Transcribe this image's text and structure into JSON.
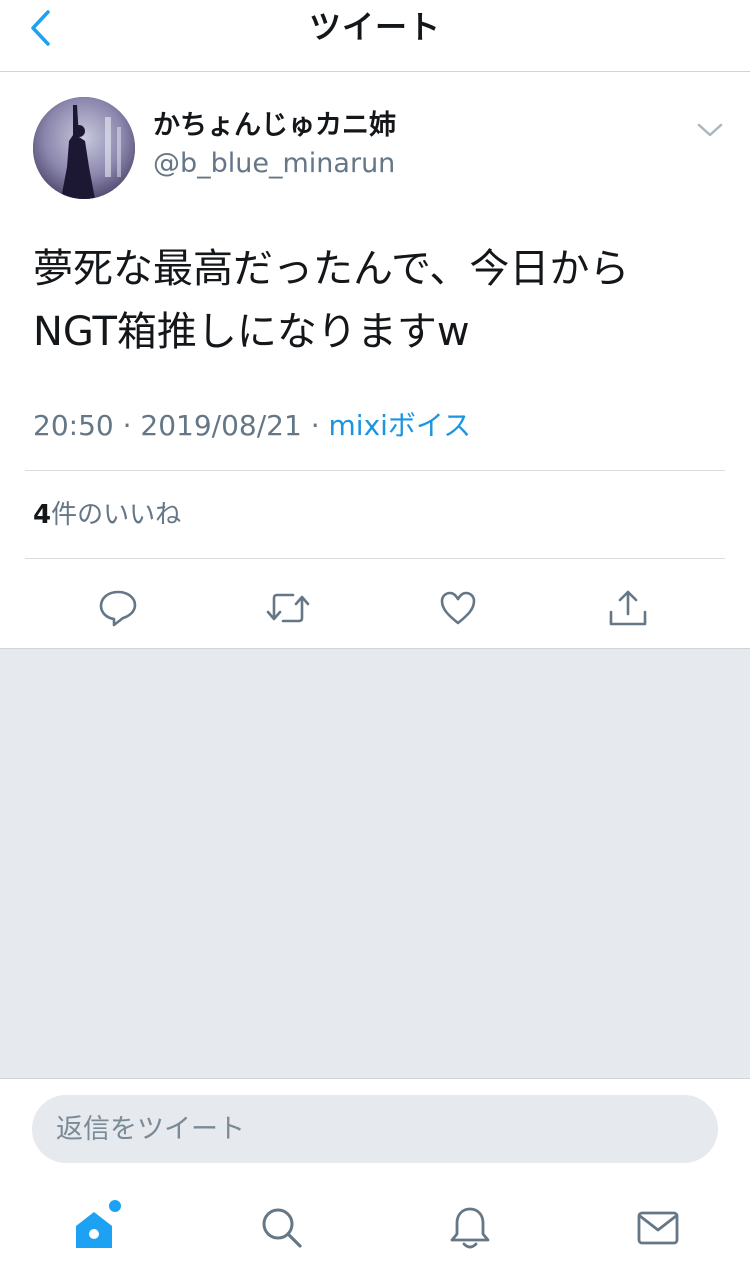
{
  "header": {
    "title": "ツイート",
    "back_icon": "chevron-left-icon"
  },
  "tweet": {
    "display_name": "かちょんじゅカニ姉",
    "handle": "@b_blue_minarun",
    "text": "夢死な最高だったんで、今日から\nNGT箱推しになりますw",
    "time": "20:50",
    "date": "2019/08/21",
    "separator": "·",
    "source": "mixiボイス",
    "likes_count": "4",
    "likes_label": "件のいいね"
  },
  "actions": {
    "reply_icon": "reply-icon",
    "retweet_icon": "retweet-icon",
    "like_icon": "heart-icon",
    "share_icon": "share-icon"
  },
  "reply": {
    "placeholder": "返信をツイート"
  },
  "tabbar": {
    "items": [
      "home-icon",
      "search-icon",
      "notifications-icon",
      "messages-icon"
    ],
    "home_has_badge": true
  },
  "colors": {
    "accent": "#1da1f2",
    "link": "#1b95e0",
    "secondary_text": "#657786",
    "background_grey": "#e6e9ed"
  }
}
